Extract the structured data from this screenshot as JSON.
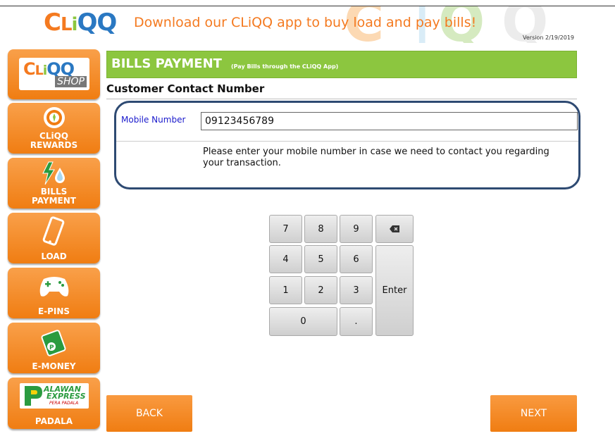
{
  "header": {
    "logo": "CLiQQ",
    "banner": "Download our CLiQQ app to buy load and pay bills!",
    "version": "Version 2/19/2019"
  },
  "sidebar": {
    "items": [
      {
        "label": "SHOP",
        "logo": "CLiQQ",
        "icon": "cliqq-shop-logo"
      },
      {
        "label": "CLiQQ\nREWARDS",
        "icon": "rewards-icon"
      },
      {
        "label": "BILLS\nPAYMENT",
        "icon": "bills-payment-icon"
      },
      {
        "label": "LOAD",
        "icon": "phone-icon"
      },
      {
        "label": "E-PINS",
        "icon": "gamepad-icon"
      },
      {
        "label": "E-MONEY",
        "icon": "money-icon"
      },
      {
        "label": "PADALA",
        "logo_line1": "ALAWAN",
        "logo_line2": "EXPRESS",
        "logo_line3": "PERA PADALA",
        "icon": "palawan-express-logo"
      }
    ]
  },
  "main": {
    "title": "BILLS PAYMENT",
    "subtitle": "(Pay Bills through the CLiQQ App)",
    "section_title": "Customer Contact Number",
    "mobile_label": "Mobile Number",
    "mobile_value": "09123456789",
    "helper_text": "Please enter your mobile number in case we need to contact you regarding your transaction."
  },
  "keypad": {
    "keys": [
      "7",
      "8",
      "9",
      "4",
      "5",
      "6",
      "1",
      "2",
      "3",
      "0",
      "."
    ],
    "enter": "Enter",
    "backspace_icon": "backspace-icon"
  },
  "footer": {
    "back": "BACK",
    "next": "NEXT"
  },
  "colors": {
    "orange": "#f07d12",
    "green": "#8cc63f",
    "navy": "#2e4a72",
    "logo_blue": "#2a78c2"
  }
}
